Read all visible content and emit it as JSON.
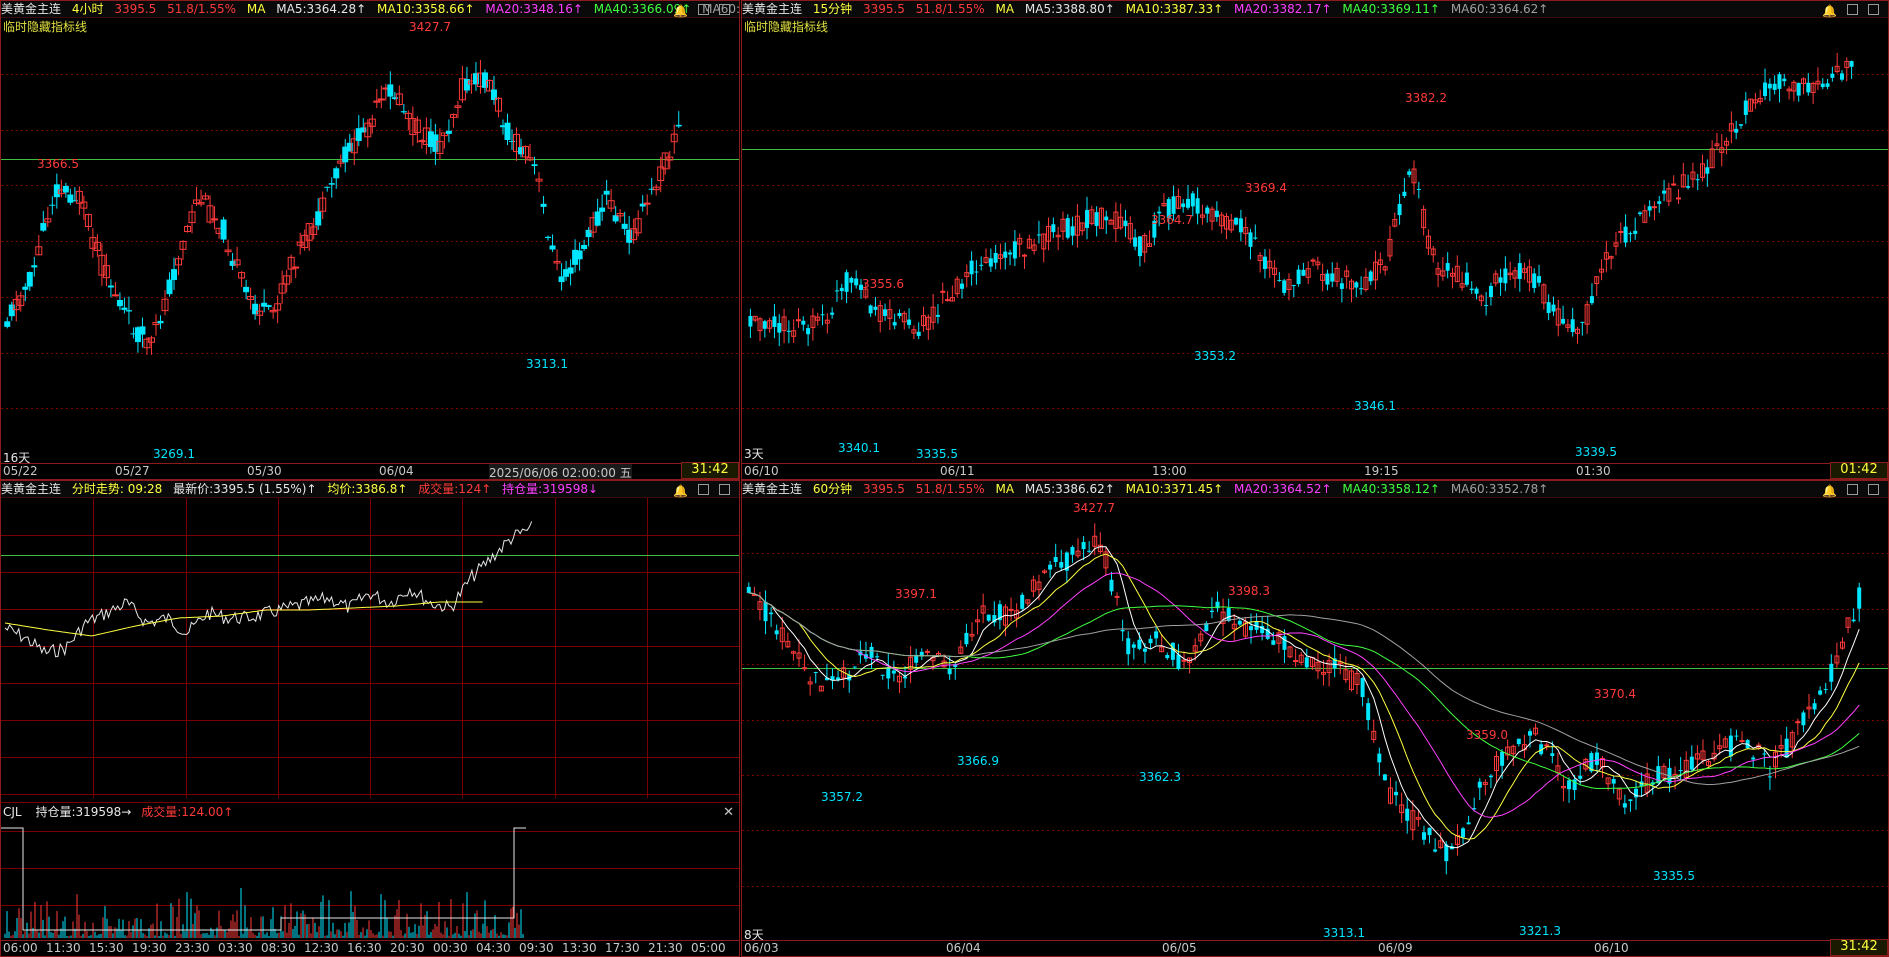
{
  "colors": {
    "up": "#ff3a3a",
    "down": "#00e6ff",
    "grid": "#7a0000",
    "ma5": "#ffffff",
    "ma10": "#ffff40",
    "ma20": "#ff40ff",
    "ma40": "#40ff40",
    "ma60": "#a0a0a0",
    "ref": "#40c040"
  },
  "p1": {
    "symbol": "美黄金主连",
    "period": "4小时",
    "price": "3395.5",
    "change": "51.8/1.55%",
    "ma": "MA",
    "ma5": "MA5:3364.28↑",
    "ma10": "MA10:3358.66↑",
    "ma20": "MA20:3348.16↑",
    "ma40": "MA40:3366.09↑",
    "ma60": "MA60:3",
    "subtitle": "临时隐藏指标线",
    "labels": {
      "hi": "3427.7",
      "mid": "3366.5",
      "lo1": "3269.1",
      "lo2": "3313.1"
    },
    "days": "16天",
    "axis": [
      "05/22",
      "05/27",
      "05/30",
      "06/04"
    ],
    "axis_time": "2025/06/06 02:00:00 五",
    "clock": "31:42"
  },
  "p2": {
    "symbol": "美黄金主连",
    "period": "15分钟",
    "price": "3395.5",
    "change": "51.8/1.55%",
    "ma": "MA",
    "ma5": "MA5:3388.80↑",
    "ma10": "MA10:3387.33↑",
    "ma20": "MA20:3382.17↑",
    "ma40": "MA40:3369.11↑",
    "ma60": "MA60:3364.62↑",
    "subtitle": "临时隐藏指标线",
    "labels": {
      "a": "3355.6",
      "b": "3364.7",
      "c": "3369.4",
      "d": "3382.2",
      "e": "3340.1",
      "f": "3335.5",
      "g": "3353.2",
      "h": "3346.1",
      "i": "3339.5"
    },
    "days": "3天",
    "axis": [
      "06/10",
      "06/11",
      "13:00",
      "19:15",
      "01:30"
    ],
    "clock": "01:42"
  },
  "p3": {
    "symbol": "美黄金主连",
    "trend": "分时走势: 09:28",
    "latest": "最新价:3395.5 (1.55%)↑",
    "avg": "均价:3386.8↑",
    "vol": "成交量:124↑",
    "oi": "持仓量:319598↓",
    "sub_name": "CJL",
    "sub_oi": "持仓量:319598→",
    "sub_vol": "成交量:124.00↑",
    "axis": [
      "06:00",
      "11:30",
      "15:30",
      "19:30",
      "23:30",
      "03:30",
      "08:30",
      "12:30",
      "16:30",
      "20:30",
      "00:30",
      "04:30",
      "09:30",
      "13:30",
      "17:30",
      "21:30",
      "05:00"
    ]
  },
  "p4": {
    "symbol": "美黄金主连",
    "period": "60分钟",
    "price": "3395.5",
    "change": "51.8/1.55%",
    "ma": "MA",
    "ma5": "MA5:3386.62↑",
    "ma10": "MA10:3371.45↑",
    "ma20": "MA20:3364.52↑",
    "ma40": "MA40:3358.12↑",
    "ma60": "MA60:3352.78↑",
    "labels": {
      "a": "3427.7",
      "b": "3397.1",
      "c": "3398.3",
      "d": "3370.4",
      "e": "3359.0",
      "f": "3357.2",
      "g": "3366.9",
      "h": "3362.3",
      "i": "3313.1",
      "j": "3321.3",
      "k": "3335.5"
    },
    "days": "8天",
    "axis": [
      "06/03",
      "06/04",
      "06/05",
      "06/09",
      "06/10"
    ],
    "clock": "31:42"
  }
}
